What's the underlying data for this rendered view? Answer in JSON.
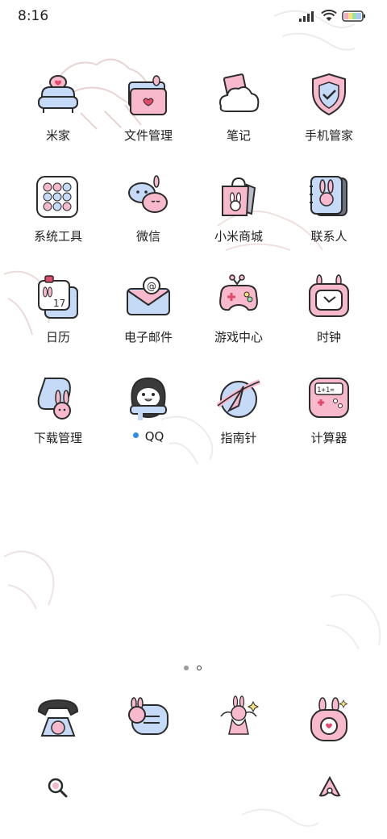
{
  "status_bar": {
    "time": "8:16",
    "icons": [
      "signal-icon",
      "wifi-icon",
      "battery-icon"
    ]
  },
  "apps": [
    [
      {
        "label": "米家",
        "icon": "sofa-icon"
      },
      {
        "label": "文件管理",
        "icon": "folder-bunny-icon"
      },
      {
        "label": "笔记",
        "icon": "cloud-note-icon"
      },
      {
        "label": "手机管家",
        "icon": "shield-check-icon"
      }
    ],
    [
      {
        "label": "系统工具",
        "icon": "tools-grid-icon"
      },
      {
        "label": "微信",
        "icon": "chat-bubbles-icon"
      },
      {
        "label": "小米商城",
        "icon": "shopping-bag-icon"
      },
      {
        "label": "联系人",
        "icon": "contacts-book-icon"
      }
    ],
    [
      {
        "label": "日历",
        "icon": "calendar-icon",
        "date": "17"
      },
      {
        "label": "电子邮件",
        "icon": "mail-icon",
        "symbol": "@"
      },
      {
        "label": "游戏中心",
        "icon": "gamepad-icon"
      },
      {
        "label": "时钟",
        "icon": "clock-tv-icon"
      }
    ],
    [
      {
        "label": "下载管理",
        "icon": "download-bunny-icon"
      },
      {
        "label": "QQ",
        "icon": "penguin-icon",
        "badge": "new-dot"
      },
      {
        "label": "指南针",
        "icon": "compass-planet-icon"
      },
      {
        "label": "计算器",
        "icon": "calculator-icon",
        "display": "1+1="
      }
    ]
  ],
  "dock": [
    {
      "icon": "phone-icon"
    },
    {
      "icon": "message-bunny-icon"
    },
    {
      "icon": "angel-bunny-icon"
    },
    {
      "icon": "camera-bunny-icon"
    }
  ],
  "bottom": {
    "left": "search-icon",
    "right": "assistant-icon"
  },
  "page_indicator": {
    "count": 2,
    "active": 1
  },
  "colors": {
    "pink": "#f8b9cc",
    "blue": "#c5daf7",
    "outline": "#2b2b2b",
    "dot_blue": "#2f8fe8"
  }
}
